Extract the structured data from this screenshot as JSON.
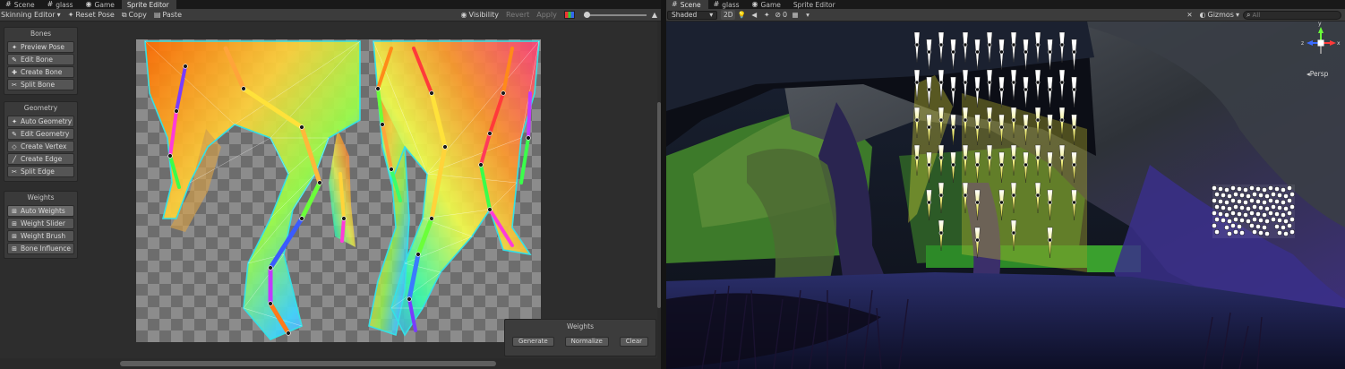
{
  "left": {
    "tabs": [
      {
        "label": "Scene",
        "icon": "grid-icon"
      },
      {
        "label": "glass",
        "icon": "grid-icon"
      },
      {
        "label": "Game",
        "icon": "gamepad-icon"
      },
      {
        "label": "Sprite Editor",
        "icon": "none"
      }
    ],
    "toolbar": {
      "mode": "Skinning Editor",
      "reset_pose": "Reset Pose",
      "copy": "Copy",
      "paste": "Paste",
      "visibility": "Visibility",
      "revert": "Revert",
      "apply": "Apply"
    },
    "panels": {
      "bones": {
        "title": "Bones",
        "items": [
          "Preview Pose",
          "Edit Bone",
          "Create Bone",
          "Split Bone"
        ]
      },
      "geometry": {
        "title": "Geometry",
        "items": [
          "Auto Geometry",
          "Edit Geometry",
          "Create Vertex",
          "Create Edge",
          "Split Edge"
        ]
      },
      "weights": {
        "title": "Weights",
        "items": [
          "Auto Weights",
          "Weight Slider",
          "Weight Brush",
          "Bone Influence"
        ]
      }
    },
    "weights_window": {
      "title": "Weights",
      "generate": "Generate",
      "normalize": "Normalize",
      "clear": "Clear"
    }
  },
  "right": {
    "tabs": [
      {
        "label": "Scene",
        "icon": "grid-icon"
      },
      {
        "label": "glass",
        "icon": "grid-icon"
      },
      {
        "label": "Game",
        "icon": "gamepad-icon"
      },
      {
        "label": "Sprite Editor",
        "icon": "none"
      }
    ],
    "toolbar": {
      "shading": "Shaded",
      "mode_2d": "2D",
      "hidden_count": "0",
      "gizmos": "Gizmos",
      "search_placeholder": "All"
    },
    "gizmo": {
      "persp_label": "Persp",
      "axes": [
        "y",
        "x",
        "z"
      ]
    }
  },
  "colors": {
    "accent_cyan": "#35e0e6",
    "outline_orange": "#f07a1e",
    "spike_yellow": "#e8e23a",
    "cave_purple": "#4a3a9a"
  }
}
